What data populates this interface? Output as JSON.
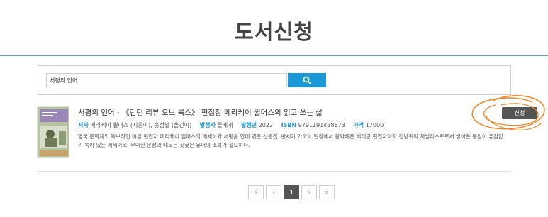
{
  "header": {
    "title": "도서신청"
  },
  "search": {
    "value": "서평의 언어",
    "button_icon": "search-icon"
  },
  "results": [
    {
      "title": "서평의 언어 - 《런던 리뷰 오브 북스》 편집장 메리케이 윌머스의 읽고 쓰는 삶",
      "author_label": "저자",
      "author": "메리케이 윌머스 (지은이), 송섬별 (옮긴이)",
      "publisher_label": "발행자",
      "publisher": "돌베개",
      "year_label": "발행년",
      "year": "2022",
      "isbn_label": "ISBN",
      "isbn": "9791191438673",
      "price_label": "가격",
      "price": "17000",
      "description": "영국 문화계의 독보적인 여성 편집자 메리케이 윌머스의 에세이와 서평을 한데 엮은 산문집. 반세기 가까이 현장에서 활약해온 베테랑 편집자이자 전방위적 저널리스트로서 쌓아온 통찰이 유감없이 녹아 있는 에세이로, 우아한 문장과 때로는 짓궂은 유머의 조화가 절묘하다.",
      "apply_label": "신청"
    }
  ],
  "pagination": {
    "first": "«",
    "prev": "‹",
    "current": "1",
    "next": "›",
    "last": "»"
  },
  "colors": {
    "accent": "#1a98d5",
    "annotation": "#f08a2c",
    "button_dark": "#555555"
  }
}
